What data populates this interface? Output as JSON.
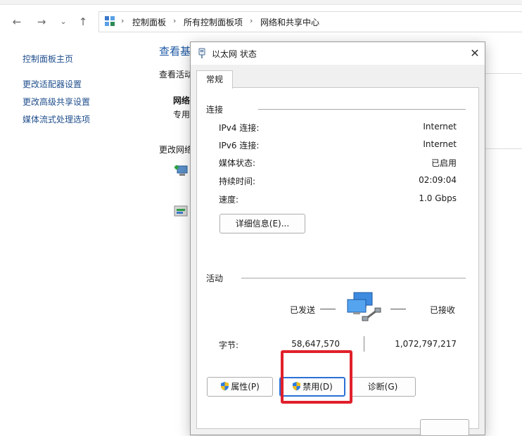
{
  "explorer": {
    "breadcrumb": [
      "控制面板",
      "所有控制面板项",
      "网络和共享中心"
    ],
    "sidebar": [
      {
        "label": "控制面板主页"
      },
      {
        "label": "更改适配器设置"
      },
      {
        "label": "更改高级共享设置"
      },
      {
        "label": "媒体流式处理选项"
      }
    ],
    "main": {
      "title": "查看基",
      "view_active": "查看活动",
      "network_name": "网络",
      "network_type": "专用",
      "change_settings": "更改网络"
    }
  },
  "dialog": {
    "title": "以太网 状态",
    "close_glyph": "✕",
    "tab": "常规",
    "connection": {
      "group": "连接",
      "rows": [
        {
          "label": "IPv4 连接:",
          "value": "Internet"
        },
        {
          "label": "IPv6 连接:",
          "value": "Internet"
        },
        {
          "label": "媒体状态:",
          "value": "已启用"
        },
        {
          "label": "持续时间:",
          "value": "02:09:04"
        },
        {
          "label": "速度:",
          "value": "1.0 Gbps"
        }
      ],
      "details_button": "详细信息(E)..."
    },
    "activity": {
      "group": "活动",
      "sent_label": "已发送",
      "received_label": "已接收",
      "bytes_label": "字节:",
      "bytes_sent": "58,647,570",
      "bytes_received": "1,072,797,217"
    },
    "buttons": {
      "properties": "属性(P)",
      "disable": "禁用(D)",
      "diagnose": "诊断(G)"
    }
  },
  "colors": {
    "link": "#1f4e8c",
    "title": "#1f5aa6",
    "highlight": "#e0202a",
    "focus": "#2a6fd6"
  },
  "icons": [
    "back-arrow-icon",
    "forward-arrow-icon",
    "chevron-down-icon",
    "up-arrow-icon",
    "control-panel-icon",
    "ethernet-icon",
    "network-computers-icon",
    "shield-icon"
  ]
}
